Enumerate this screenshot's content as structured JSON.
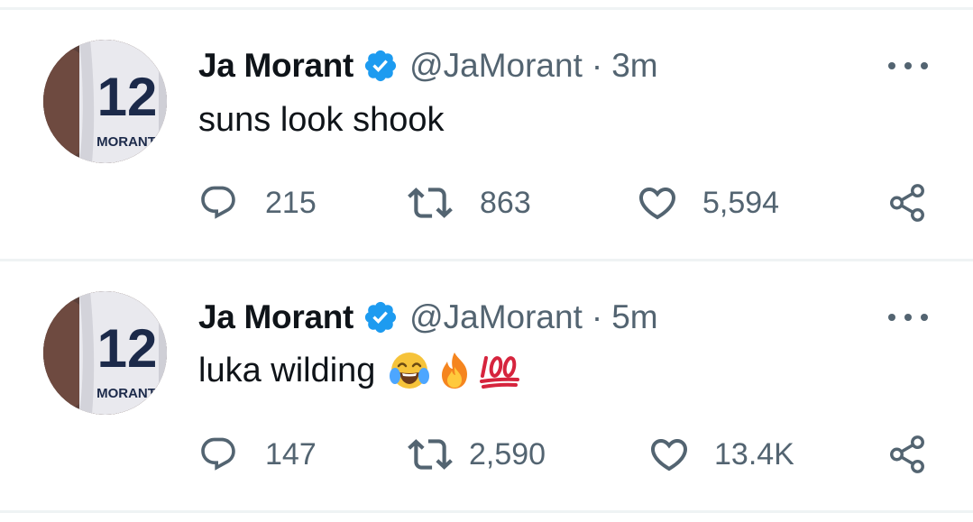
{
  "tweets": [
    {
      "name": "Ja Morant",
      "handle": "@JaMorant",
      "separator": "·",
      "time": "3m",
      "text": "suns look shook",
      "emojis": [],
      "replies": "215",
      "retweets": "863",
      "likes": "5,594",
      "avatar": {
        "jersey_number": "12",
        "jersey_name": "MORANT"
      }
    },
    {
      "name": "Ja Morant",
      "handle": "@JaMorant",
      "separator": "·",
      "time": "5m",
      "text": "luka wilding",
      "emojis": [
        "face-with-tears-of-joy",
        "fire",
        "hundred-points"
      ],
      "replies": "147",
      "retweets": "2,590",
      "likes": "13.4K",
      "avatar": {
        "jersey_number": "12",
        "jersey_name": "MORANT"
      }
    }
  ],
  "icons": {
    "verified": "verified-badge-icon",
    "more": "more-options-icon",
    "reply": "reply-icon",
    "retweet": "retweet-icon",
    "like": "heart-icon",
    "share": "share-icon"
  },
  "colors": {
    "verified": "#1d9bf0",
    "text_primary": "#0f1419",
    "text_secondary": "#536471",
    "divider": "#eff3f4"
  }
}
